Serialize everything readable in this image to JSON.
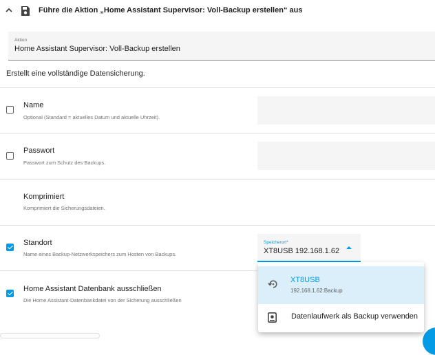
{
  "header": {
    "title": "Führe die Aktion „Home Assistant Supervisor: Voll-Backup erstellen“ aus"
  },
  "action_field": {
    "label": "Aktion",
    "value": "Home Assistant Supervisor: Voll-Backup erstellen"
  },
  "description": "Erstellt eine vollständige Datensicherung.",
  "fields": {
    "name": {
      "title": "Name",
      "description": "Optional (Standard = aktuelles Datum und aktuelle Uhrzeit).",
      "checked": false
    },
    "password": {
      "title": "Passwort",
      "description": "Passwort zum Schutz des Backups.",
      "checked": false
    },
    "compressed": {
      "title": "Komprimiert",
      "description": "Komprimiert die Sicherungsdateien."
    },
    "location": {
      "title": "Standort",
      "description": "Name eines Backup-Netzwerkspeichers zum Hosten von Backups.",
      "checked": true
    },
    "exclude_db": {
      "title": "Home Assistant Datenbank ausschließen",
      "description": "Die Home Assistant-Datenbankdatei von der Sicherung ausschließen",
      "checked": true
    }
  },
  "location_select": {
    "label": "Speicherort*",
    "value": "XT8USB 192.168.1.62"
  },
  "dropdown": {
    "items": [
      {
        "title": "XT8USB",
        "subtitle": "192.168.1.62:Backup",
        "icon": "network-backup-icon",
        "selected": true
      },
      {
        "title": "Datenlaufwerk als Backup verwenden",
        "icon": "harddisk-icon",
        "selected": false
      }
    ]
  },
  "colors": {
    "accent": "#039be5",
    "selected_bg": "#dbeffa",
    "field_bg": "#f5f5f5",
    "divider": "#e0e0e0"
  }
}
